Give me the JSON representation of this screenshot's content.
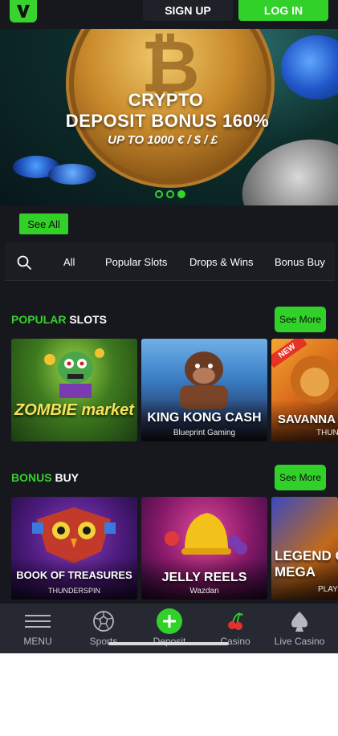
{
  "header": {
    "signup_label": "SIGN UP",
    "login_label": "LOG IN"
  },
  "banner": {
    "line1": "CRYPTO",
    "line2": "DEPOSIT BONUS 160%",
    "line3": "UP TO 1000 € / $ / £",
    "slides_count": 3,
    "active_slide": 3
  },
  "see_all_label": "See All",
  "filters": [
    "All",
    "Popular Slots",
    "Drops & Wins",
    "Bonus Buy"
  ],
  "sections": {
    "popular": {
      "title_accent": "POPULAR",
      "title_rest": "SLOTS",
      "see_more": "See More",
      "games": [
        {
          "title": "ZOMBIE market",
          "provider": ""
        },
        {
          "title": "KING KONG CASH",
          "provider": "Blueprint Gaming"
        },
        {
          "title": "SAVANNA",
          "provider": "THUND",
          "badge": "NEW"
        }
      ]
    },
    "bonus": {
      "title_accent": "BONUS",
      "title_rest": "BUY",
      "see_more": "See More",
      "games": [
        {
          "title": "BOOK OF TREASURES",
          "provider": "THUNDERSPIN"
        },
        {
          "title": "JELLY REELS",
          "provider": "Wazdan"
        },
        {
          "title": "LEGEND OF MEGA",
          "provider": "PLAY"
        }
      ]
    }
  },
  "bottom_nav": {
    "items": [
      {
        "label": "MENU",
        "icon": "hamburger-icon"
      },
      {
        "label": "Sports",
        "icon": "soccer-ball-icon"
      },
      {
        "label": "Deposit",
        "icon": "plus-circle-icon"
      },
      {
        "label": "Casino",
        "icon": "cherry-icon"
      },
      {
        "label": "Live Casino",
        "icon": "spade-icon"
      }
    ]
  },
  "colors": {
    "accent": "#32d12a",
    "background": "#16181d",
    "nav_background": "#262932"
  }
}
